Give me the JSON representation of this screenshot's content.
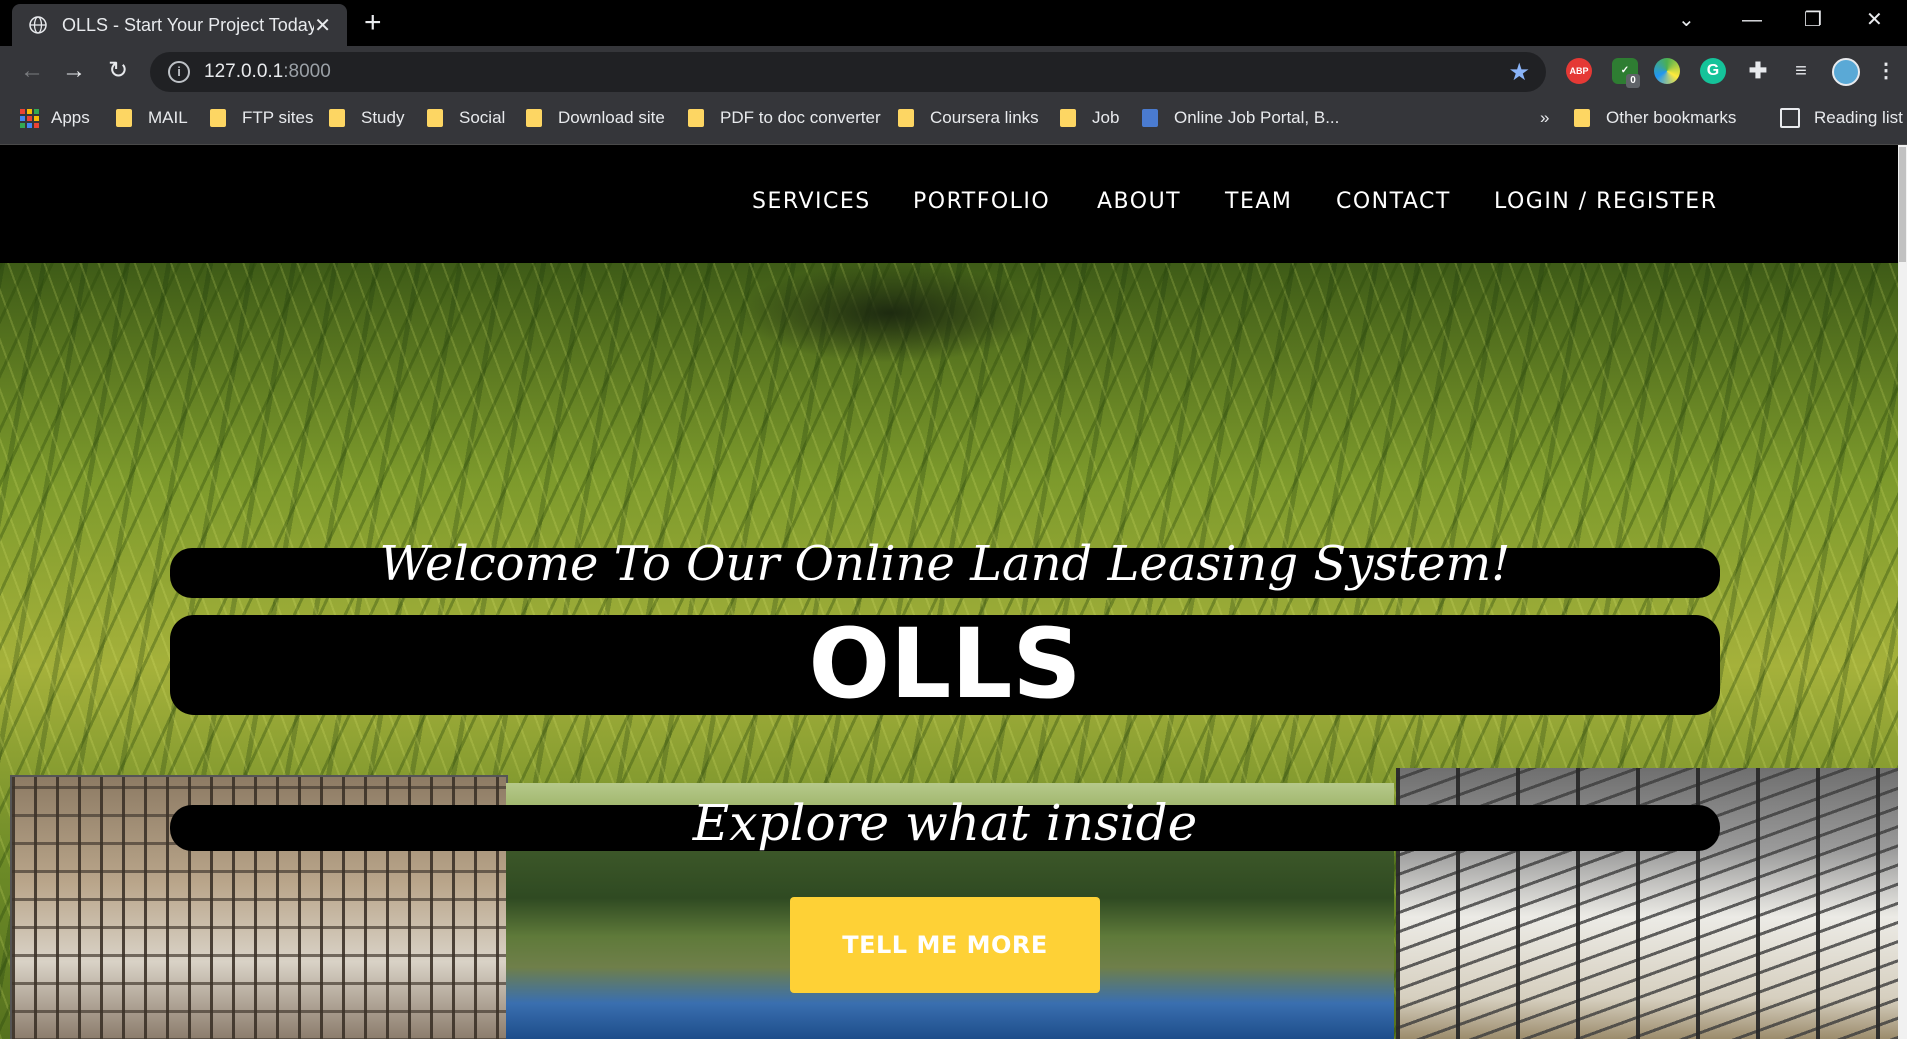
{
  "browser": {
    "tab_title": "OLLS - Start Your Project Today",
    "tab_close": "✕",
    "new_tab": "+",
    "url_host": "127.0.0.1",
    "url_port": ":8000",
    "window_buttons": {
      "dropdown": "⌄",
      "minimize": "—",
      "restore": "❐",
      "close": "✕"
    },
    "extensions": [
      "ABP",
      "0"
    ],
    "bookmarks": [
      "Apps",
      "MAIL",
      "FTP sites",
      "Study",
      "Social",
      "Download site",
      "PDF to doc converter",
      "Coursera links",
      "Job",
      "Online Job Portal, B..."
    ],
    "more_bookmarks": "»",
    "other_bookmarks": "Other bookmarks",
    "reading_list": "Reading list"
  },
  "site_nav": {
    "items": [
      "SERVICES",
      "PORTFOLIO",
      "ABOUT",
      "TEAM",
      "CONTACT",
      "LOGIN / REGISTER"
    ]
  },
  "hero": {
    "welcome": "Welcome To Our Online Land Leasing System!",
    "brand": "OLLS",
    "explore": "Explore what inside",
    "cta_label": "TELL ME MORE"
  },
  "colors": {
    "cta": "#fed136",
    "nav_bg": "#000000",
    "chrome_bg": "#35363a"
  }
}
